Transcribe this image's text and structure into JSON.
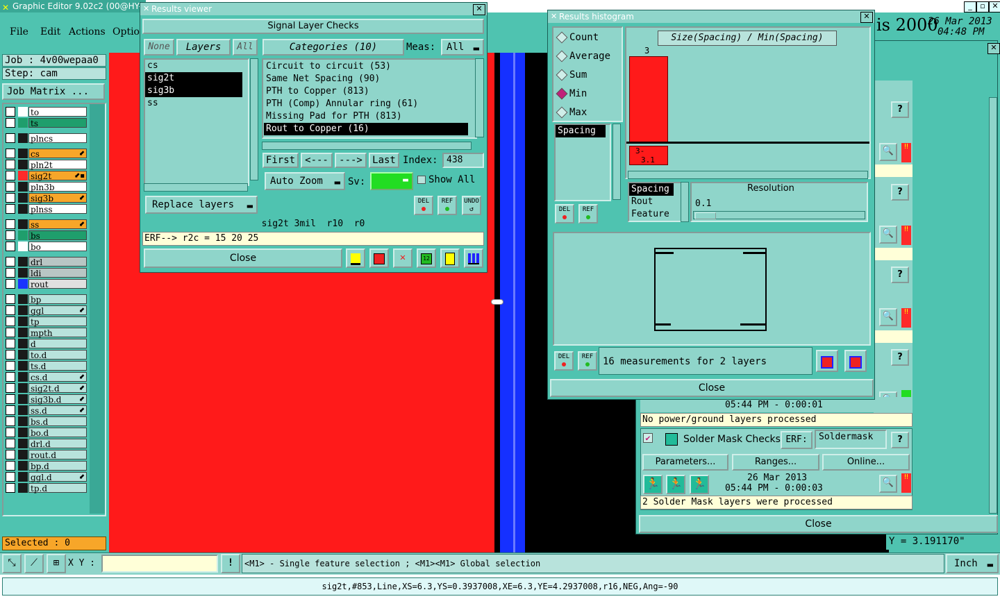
{
  "main_window": {
    "title": "Graphic Editor 9.02c2 (00@HY-H",
    "menu": [
      "File",
      "Edit",
      "Actions",
      "Optio"
    ],
    "brand_fragment": "is 2000",
    "date": "26 Mar 2013",
    "time": "04:48 PM"
  },
  "left_panel": {
    "job_label": "Job : 4v00wepaa0",
    "step_label": "Step: cam",
    "job_matrix_button": "Job Matrix ...",
    "selected_label": "Selected : 0",
    "layers": [
      {
        "name": "to",
        "color": "#ffffff",
        "swatch": "#ffffff",
        "mark": ""
      },
      {
        "name": "ts",
        "color": "#1f9e6c",
        "swatch": "#1f9e6c",
        "mark": ""
      },
      {
        "name": "plncs",
        "color": "#ffffff",
        "swatch": "#1a1a1a",
        "mark": ""
      },
      {
        "name": "cs",
        "color": "#f7a629",
        "swatch": "#1a1a1a",
        "mark": "⬋"
      },
      {
        "name": "pln2t",
        "color": "#ffffff",
        "swatch": "#1a1a1a",
        "mark": ""
      },
      {
        "name": "sig2t",
        "color": "#f7a629",
        "swatch": "#ff2a2a",
        "mark": "⬋▪"
      },
      {
        "name": "pln3b",
        "color": "#ffffff",
        "swatch": "#1a1a1a",
        "mark": ""
      },
      {
        "name": "sig3b",
        "color": "#f7a629",
        "swatch": "#1a1a1a",
        "mark": "⬋"
      },
      {
        "name": "plnss",
        "color": "#ffffff",
        "swatch": "#1a1a1a",
        "mark": ""
      },
      {
        "name": "ss",
        "color": "#f7a629",
        "swatch": "#1a1a1a",
        "mark": "⬋"
      },
      {
        "name": "bs",
        "color": "#1f9e6c",
        "swatch": "#1f9e6c",
        "mark": ""
      },
      {
        "name": "bo",
        "color": "#ffffff",
        "swatch": "#ffffff",
        "mark": ""
      },
      {
        "name": "drl",
        "color": "#b8c6c4",
        "swatch": "#1a1a1a",
        "mark": ""
      },
      {
        "name": "ldi",
        "color": "#b8c6c4",
        "swatch": "#1a1a1a",
        "mark": ""
      },
      {
        "name": "rout",
        "color": "#e0e0e0",
        "swatch": "#1a33ff",
        "mark": ""
      },
      {
        "name": "bp",
        "color": "#b8e3dc",
        "swatch": "#1a1a1a",
        "mark": ""
      },
      {
        "name": "ggl",
        "color": "#b8e3dc",
        "swatch": "#1a1a1a",
        "mark": "⬋"
      },
      {
        "name": "tp",
        "color": "#b8e3dc",
        "swatch": "#1a1a1a",
        "mark": ""
      },
      {
        "name": "mpth",
        "color": "#b8e3dc",
        "swatch": "#1a1a1a",
        "mark": ""
      },
      {
        "name": "d",
        "color": "#b8e3dc",
        "swatch": "#1a1a1a",
        "mark": ""
      },
      {
        "name": "to.d",
        "color": "#b8e3dc",
        "swatch": "#1a1a1a",
        "mark": ""
      },
      {
        "name": "ts.d",
        "color": "#b8e3dc",
        "swatch": "#1a1a1a",
        "mark": ""
      },
      {
        "name": "cs.d",
        "color": "#b8e3dc",
        "swatch": "#1a1a1a",
        "mark": "⬋"
      },
      {
        "name": "sig2t.d",
        "color": "#b8e3dc",
        "swatch": "#1a1a1a",
        "mark": "⬋"
      },
      {
        "name": "sig3b.d",
        "color": "#b8e3dc",
        "swatch": "#1a1a1a",
        "mark": "⬋"
      },
      {
        "name": "ss.d",
        "color": "#b8e3dc",
        "swatch": "#1a1a1a",
        "mark": "⬋"
      },
      {
        "name": "bs.d",
        "color": "#b8e3dc",
        "swatch": "#1a1a1a",
        "mark": ""
      },
      {
        "name": "bo.d",
        "color": "#b8e3dc",
        "swatch": "#1a1a1a",
        "mark": ""
      },
      {
        "name": "drl.d",
        "color": "#b8e3dc",
        "swatch": "#1a1a1a",
        "mark": ""
      },
      {
        "name": "rout.d",
        "color": "#b8e3dc",
        "swatch": "#1a1a1a",
        "mark": ""
      },
      {
        "name": "bp.d",
        "color": "#b8e3dc",
        "swatch": "#1a1a1a",
        "mark": ""
      },
      {
        "name": "ggl.d",
        "color": "#b8e3dc",
        "swatch": "#1a1a1a",
        "mark": "⬋"
      },
      {
        "name": "tp.d",
        "color": "#b8e3dc",
        "swatch": "#1a1a1a",
        "mark": ""
      }
    ]
  },
  "results_viewer": {
    "title": "Results viewer",
    "header": "Signal Layer Checks",
    "none_btn": "None",
    "layers_btn": "Layers",
    "all_btn": "All",
    "categories_btn": "Categories (10)",
    "meas_label": "Meas:",
    "meas_value": "All",
    "layer_list": [
      "cs",
      "sig2t",
      "sig3b",
      "ss"
    ],
    "categories": [
      "Circuit to circuit (53)",
      "Same Net Spacing (90)",
      "PTH to Copper (813)",
      "PTH (Comp) Annular ring (61)",
      "Missing Pad for PTH (813)",
      "Rout to Copper (16)"
    ],
    "first_btn": "First",
    "prev_btn": "<---",
    "next_btn": "--->",
    "last_btn": "Last",
    "index_label": "Index:",
    "index_value": "438",
    "auto_zoom": "Auto Zoom",
    "sv_label": "Sv:",
    "show_all": "Show All",
    "replace_layers": "Replace layers",
    "del": "DEL",
    "ref": "REF",
    "undo": "UNDO",
    "info_line": "sig2t 3mil  r10  r0",
    "erf_line": "ERF--> r2c = 15 20 25",
    "close": "Close"
  },
  "results_histogram": {
    "title": "Results histogram",
    "radio_options": [
      "Count",
      "Average",
      "Sum",
      "Min",
      "Max"
    ],
    "selected_radio": "Min",
    "list_item": "Spacing",
    "chart_title": "Size(Spacing) / Min(Spacing)",
    "bar_label_top": "3",
    "bar_label_bottom_1": "3-",
    "bar_label_bottom_2": "3.1",
    "feature_list": [
      "Spacing",
      "Rout",
      "Feature"
    ],
    "resolution_label": "Resolution",
    "resolution_value": "0.1",
    "del": "DEL",
    "ref": "REF",
    "measurements_text": "16 measurements for 2 layers",
    "close": "Close"
  },
  "checklist_window": {
    "power_row_time": "05:44 PM - 0:00:01",
    "power_message": "No power/ground layers processed",
    "solder_title": "Solder Mask Checks",
    "erf_label": "ERF:",
    "erf_value": "Soldermask",
    "parameters_btn": "Parameters...",
    "ranges_btn": "Ranges...",
    "online_btn": "Online...",
    "solder_date": "26 Mar 2013",
    "solder_time": "05:44 PM - 0:00:03",
    "solder_message": "2 Solder Mask layers were processed",
    "close": "Close",
    "help": "?"
  },
  "coordinate_readout": "Y = 3.191170\"",
  "bottom_bar": {
    "xy_label": "X Y :",
    "xy_value": "",
    "hint": "<M1> - Single feature selection ; <M1><M1> Global selection",
    "unit": "Inch",
    "status": "sig2t,#853,Line,XS=6.3,YS=0.3937008,XE=6.3,YE=4.2937008,r16,NEG,Ang=-90"
  }
}
